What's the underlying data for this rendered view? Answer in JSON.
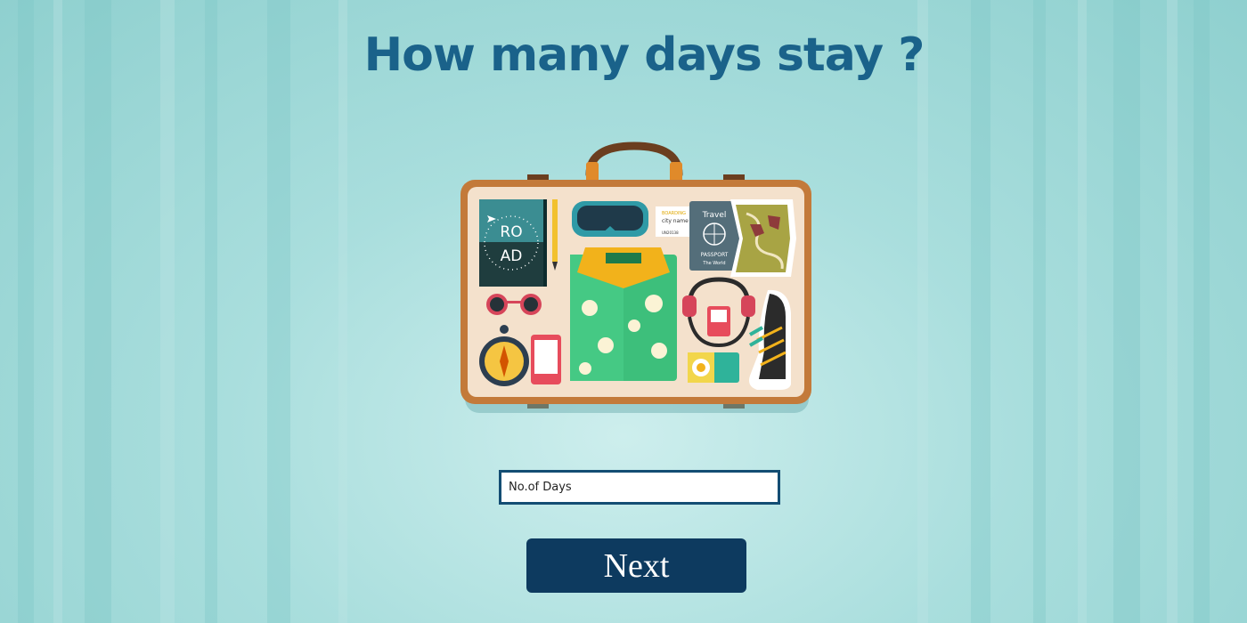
{
  "page": {
    "title": "How many days stay ?"
  },
  "illustration": {
    "name": "packed-suitcase",
    "notebook_lines": [
      "RO",
      "AD"
    ],
    "boarding_pass": {
      "header": "BOARDING",
      "city": "city name",
      "code": "UN20138"
    },
    "passport": {
      "top": "Travel",
      "label": "PASSPORT",
      "sub": "The World"
    }
  },
  "form": {
    "days_placeholder": "No.of Days",
    "days_value": ""
  },
  "actions": {
    "next_label": "Next"
  },
  "colors": {
    "title": "#1a628a",
    "button": "#0d3a5f",
    "input_border": "#134d73",
    "background": "#a9dedd"
  }
}
